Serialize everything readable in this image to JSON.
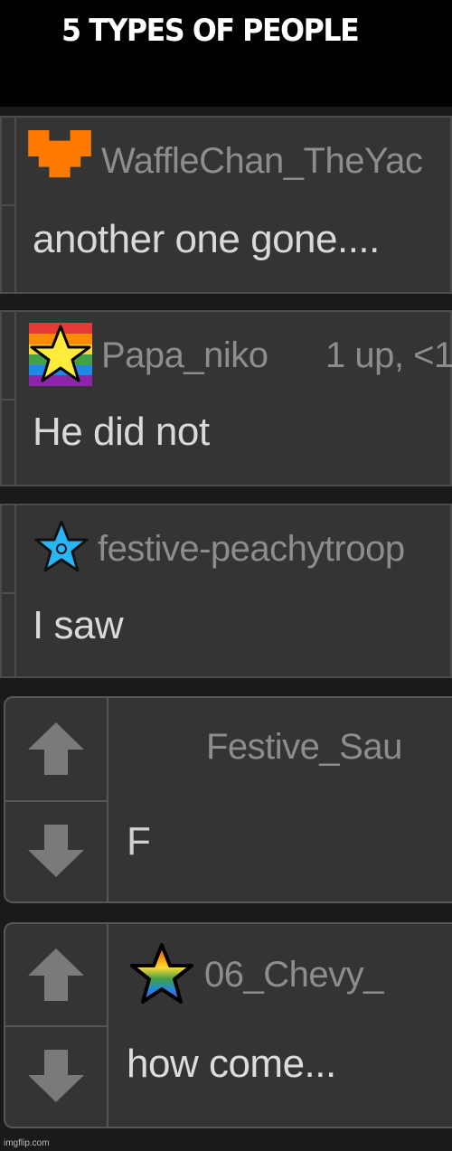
{
  "header": {
    "title": "5 TYPES OF PEOPLE"
  },
  "comments": [
    {
      "username": "WaffleChan_TheYac",
      "text": "another one gone....",
      "icon": "orange-heart-icon"
    },
    {
      "username": "Papa_niko",
      "meta": "1 up, <1",
      "text": "He did not",
      "icon": "rainbow-star-icon"
    },
    {
      "username": "festive-peachytroop",
      "text": "I saw",
      "icon": "blue-star-icon"
    },
    {
      "username": "Festive_Sau",
      "text": "F",
      "icon": ""
    },
    {
      "username": "06_Chevy_",
      "text": "how come...",
      "icon": "rainbow-star-outline-icon"
    }
  ],
  "watermark": "imgflip.com",
  "colors": {
    "background": "#1a1a1a",
    "header": "#000000",
    "panel": "#343434",
    "username": "#8d8d8d",
    "text": "#d9d9d9",
    "heart": "#ff7a00",
    "arrow": "#7a7a7a"
  }
}
